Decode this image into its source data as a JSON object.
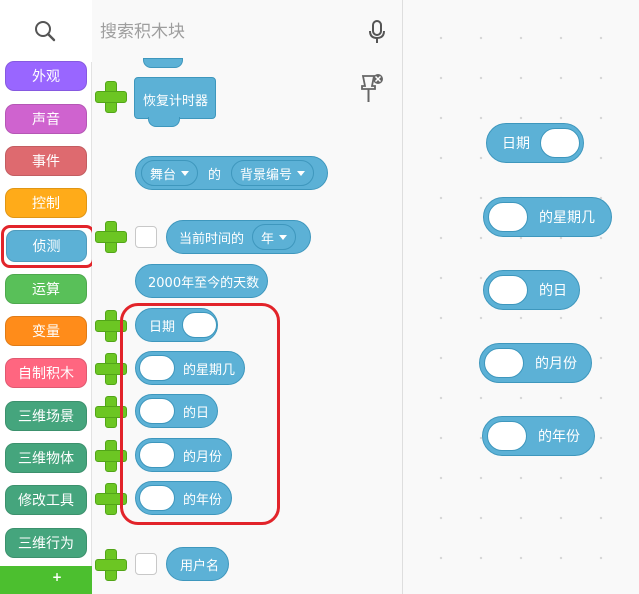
{
  "search": {
    "placeholder": "搜索积木块"
  },
  "categories": [
    {
      "label": "外观",
      "color": "#9966ff",
      "selected": false
    },
    {
      "label": "声音",
      "color": "#cf63cf",
      "selected": false
    },
    {
      "label": "事件",
      "color": "#de6a6f",
      "selected": false
    },
    {
      "label": "控制",
      "color": "#ffab19",
      "selected": false
    },
    {
      "label": "侦测",
      "color": "#5cb1d6",
      "selected": true
    },
    {
      "label": "运算",
      "color": "#59c059",
      "selected": false
    },
    {
      "label": "变量",
      "color": "#ff8c1a",
      "selected": false
    },
    {
      "label": "自制积木",
      "color": "#ff6680",
      "selected": false
    },
    {
      "label": "三维场景",
      "color": "#45a57d",
      "selected": false
    },
    {
      "label": "三维物体",
      "color": "#45a57d",
      "selected": false
    },
    {
      "label": "修改工具",
      "color": "#45a57d",
      "selected": false
    },
    {
      "label": "三维行为",
      "color": "#45a57d",
      "selected": false
    }
  ],
  "bottom_bar": {
    "glyph": "+"
  },
  "palette": {
    "reset_timer": "恢复计时器",
    "stage_block": {
      "target": "舞台",
      "of": "的",
      "property": "背景编号"
    },
    "current_time": {
      "label": "当前时间的",
      "unit": "年"
    },
    "days_since_2000": "2000年至今的天数",
    "date": "日期",
    "weekday": "的星期几",
    "day": "的日",
    "month": "的月份",
    "year": "的年份",
    "username": "用户名"
  },
  "workspace": {
    "date": "日期",
    "weekday": "的星期几",
    "day": "的日",
    "month": "的月份",
    "year": "的年份"
  },
  "colors": {
    "sensing": "#5cb1d6",
    "sensing_border": "#3e97bd",
    "highlight": "#e2242a",
    "add": "#6cc623"
  }
}
